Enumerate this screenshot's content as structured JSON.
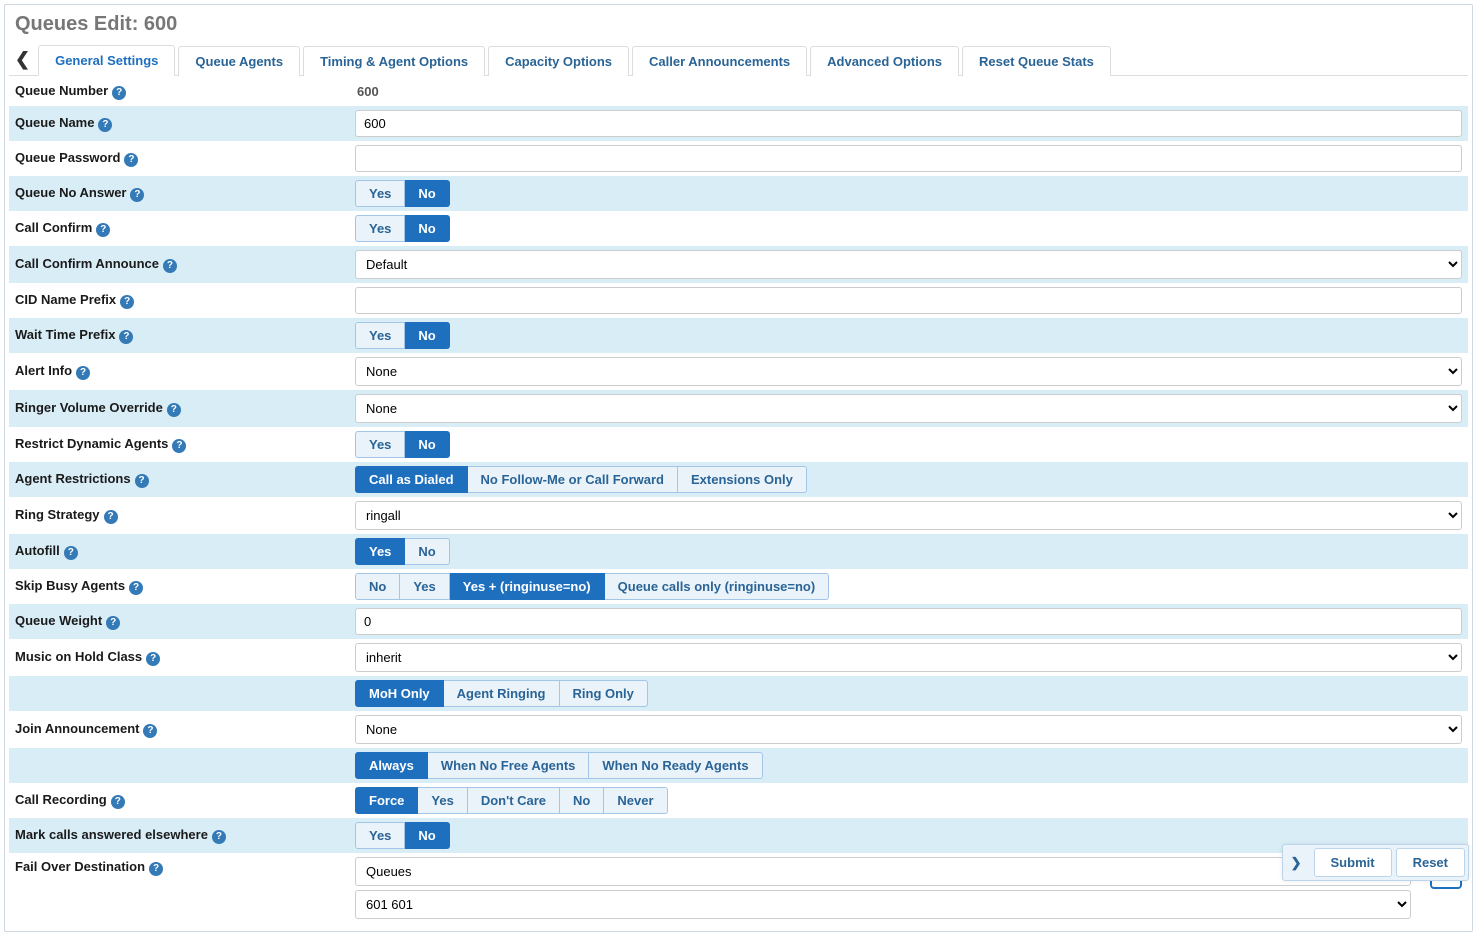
{
  "page_title": "Queues Edit: 600",
  "tabs": {
    "general": "General Settings",
    "agents": "Queue Agents",
    "timing": "Timing & Agent Options",
    "capacity": "Capacity Options",
    "announcements": "Caller Announcements",
    "advanced": "Advanced Options",
    "reset": "Reset Queue Stats"
  },
  "labels": {
    "queue_number": "Queue Number",
    "queue_name": "Queue Name",
    "queue_password": "Queue Password",
    "queue_no_answer": "Queue No Answer",
    "call_confirm": "Call Confirm",
    "call_confirm_announce": "Call Confirm Announce",
    "cid_name_prefix": "CID Name Prefix",
    "wait_time_prefix": "Wait Time Prefix",
    "alert_info": "Alert Info",
    "ringer_volume_override": "Ringer Volume Override",
    "restrict_dynamic_agents": "Restrict Dynamic Agents",
    "agent_restrictions": "Agent Restrictions",
    "ring_strategy": "Ring Strategy",
    "autofill": "Autofill",
    "skip_busy_agents": "Skip Busy Agents",
    "queue_weight": "Queue Weight",
    "music_on_hold_class": "Music on Hold Class",
    "join_announcement": "Join Announcement",
    "call_recording": "Call Recording",
    "mark_answered_elsewhere": "Mark calls answered elsewhere",
    "fail_over_destination": "Fail Over Destination"
  },
  "values": {
    "queue_number": "600",
    "queue_name": "600",
    "queue_password": "",
    "call_confirm_announce": "Default",
    "cid_name_prefix": "",
    "alert_info": "None",
    "ringer_volume_override": "None",
    "ring_strategy": "ringall",
    "queue_weight": "0",
    "music_on_hold_class": "inherit",
    "join_announcement": "None",
    "fail_over_1": "Queues",
    "fail_over_2": "601 601"
  },
  "opts": {
    "yes": "Yes",
    "no": "No",
    "call_as_dialed": "Call as Dialed",
    "no_followme": "No Follow-Me or Call Forward",
    "extensions_only": "Extensions Only",
    "skip_no": "No",
    "skip_yes": "Yes",
    "skip_yes_ring": "Yes + (ringinuse=no)",
    "skip_queue_only": "Queue calls only (ringinuse=no)",
    "moh_only": "MoH Only",
    "agent_ringing": "Agent Ringing",
    "ring_only": "Ring Only",
    "always": "Always",
    "when_no_free": "When No Free Agents",
    "when_no_ready": "When No Ready Agents",
    "force": "Force",
    "rec_yes": "Yes",
    "dont_care": "Don't Care",
    "rec_no": "No",
    "never": "Never"
  },
  "footer": {
    "submit": "Submit",
    "reset": "Reset"
  },
  "help_glyph": "?"
}
